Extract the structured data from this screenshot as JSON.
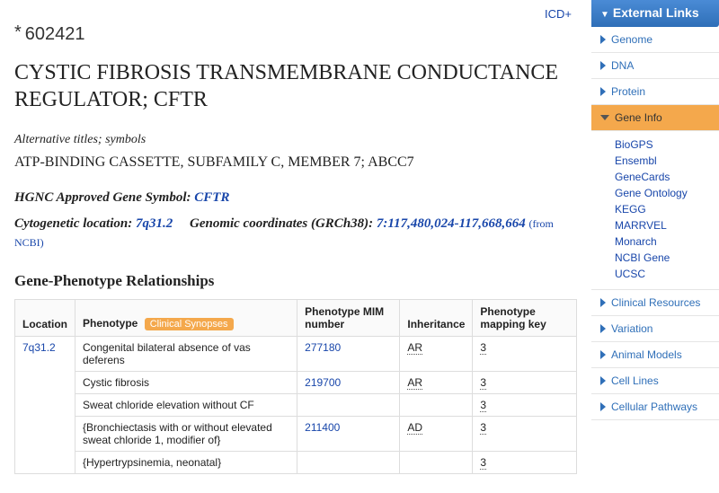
{
  "top_link": "ICD+",
  "mim_prefix": "*",
  "mim_number": "602421",
  "title": "CYSTIC FIBROSIS TRANSMEMBRANE CONDUCTANCE REGULATOR; CFTR",
  "alt_heading": "Alternative titles; symbols",
  "alt_body": "ATP-BINDING CASSETTE, SUBFAMILY C, MEMBER 7; ABCC7",
  "hgnc_label": "HGNC Approved Gene Symbol:",
  "hgnc_symbol": "CFTR",
  "cyto_label": "Cytogenetic location:",
  "cyto_val": "7q31.2",
  "genomic_label": "Genomic coordinates (GRCh38):",
  "genomic_val": "7:117,480,024-117,668,664",
  "genomic_src": "(from NCBI)",
  "section_title": "Gene-Phenotype Relationships",
  "badge": "Clinical Synopses",
  "columns": {
    "c0": "Location",
    "c1": "Phenotype",
    "c2": "Phenotype MIM number",
    "c3": "Inheritance",
    "c4": "Phenotype mapping key"
  },
  "loc_cell": "7q31.2",
  "rows": [
    {
      "phenotype": "Congenital bilateral absence of vas deferens",
      "mim": "277180",
      "inh": "AR",
      "key": "3"
    },
    {
      "phenotype": "Cystic fibrosis",
      "mim": "219700",
      "inh": "AR",
      "key": "3"
    },
    {
      "phenotype": "Sweat chloride elevation without CF",
      "mim": "",
      "inh": "",
      "key": "3"
    },
    {
      "phenotype": "{Bronchiectasis with or without elevated sweat chloride 1, modifier of}",
      "mim": "211400",
      "inh": "AD",
      "key": "3"
    },
    {
      "phenotype": "{Hypertrypsinemia, neonatal}",
      "mim": "",
      "inh": "",
      "key": "3"
    }
  ],
  "sidebar": {
    "header": "External Links",
    "items": [
      {
        "label": "Genome",
        "expanded": false
      },
      {
        "label": "DNA",
        "expanded": false
      },
      {
        "label": "Protein",
        "expanded": false
      },
      {
        "label": "Gene Info",
        "expanded": true,
        "children": [
          "BioGPS",
          "Ensembl",
          "GeneCards",
          "Gene Ontology",
          "KEGG",
          "MARRVEL",
          "Monarch",
          "NCBI Gene",
          "UCSC"
        ]
      },
      {
        "label": "Clinical Resources",
        "expanded": false
      },
      {
        "label": "Variation",
        "expanded": false
      },
      {
        "label": "Animal Models",
        "expanded": false
      },
      {
        "label": "Cell Lines",
        "expanded": false
      },
      {
        "label": "Cellular Pathways",
        "expanded": false
      }
    ]
  }
}
